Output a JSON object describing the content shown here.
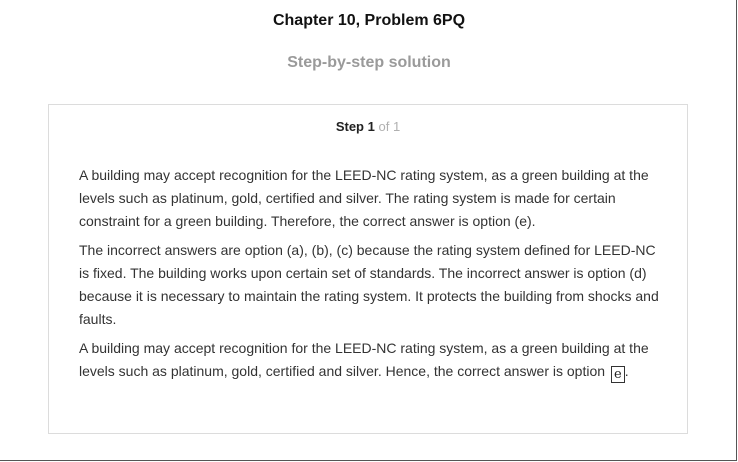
{
  "page": {
    "title": "Chapter 10, Problem 6PQ",
    "subtitle": "Step-by-step solution"
  },
  "step": {
    "label": "Step",
    "number": "1",
    "of_text": "of 1"
  },
  "content": {
    "paragraph1": "A building may accept recognition for the LEED-NC rating system, as a green building at the levels such as platinum, gold, certified and silver. The rating system is made for certain constraint for a green building. Therefore, the correct answer is option (e).",
    "paragraph2": "The incorrect answers are option (a), (b), (c) because the rating system defined for LEED-NC is fixed. The building works upon certain set of standards. The incorrect answer is option (d) because it is necessary to maintain the rating system. It protects the building from shocks and faults.",
    "paragraph3": "A building may accept recognition for the LEED-NC rating system, as a green building at the levels such as platinum, gold, certified and silver. Hence, the correct answer is option",
    "answer": "e",
    "end_punct": "."
  }
}
